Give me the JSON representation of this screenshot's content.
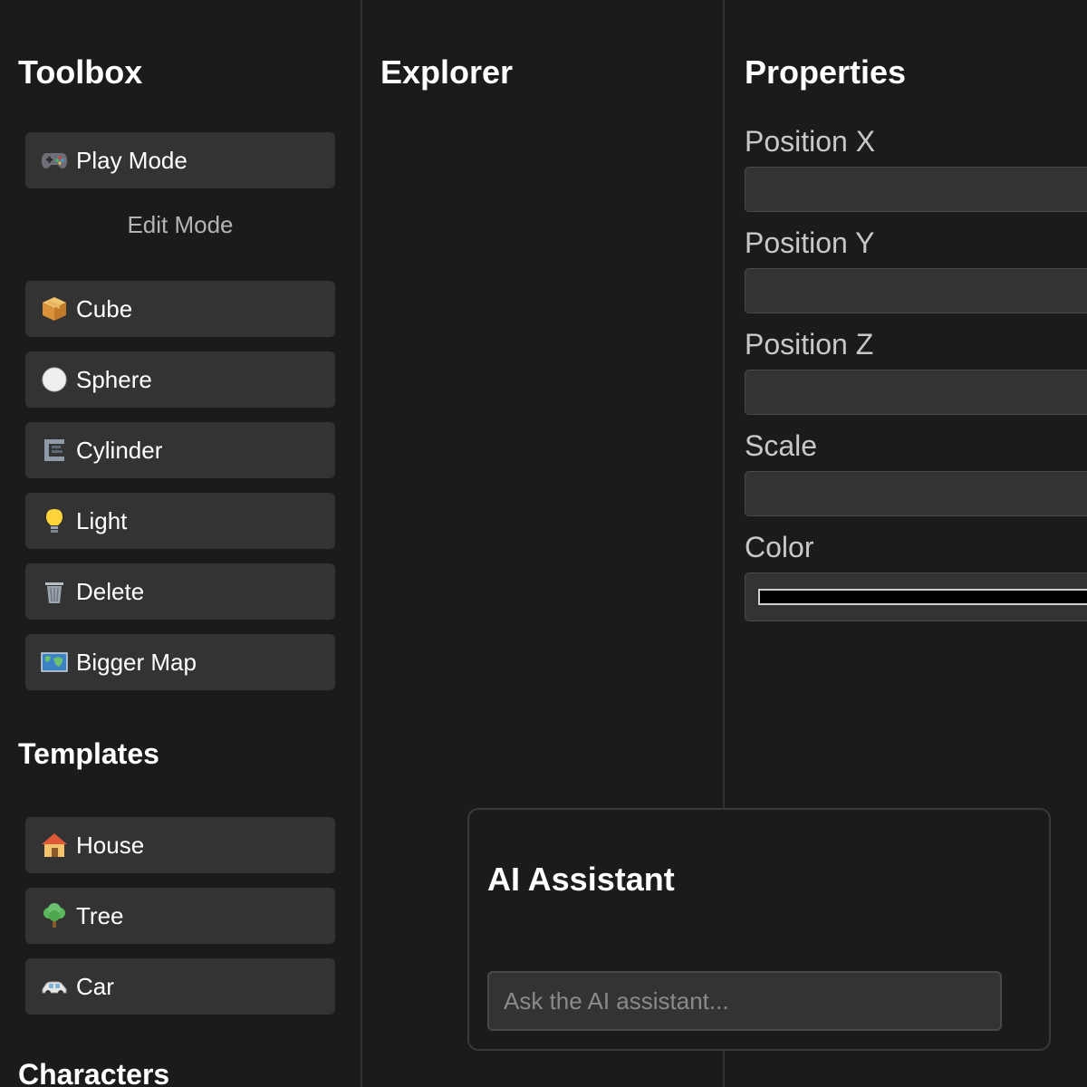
{
  "toolbox": {
    "title": "Toolbox",
    "play_mode": {
      "label": "Play Mode",
      "icon": "gamepad-icon"
    },
    "edit_mode": {
      "label": "Edit Mode"
    },
    "tools": [
      {
        "label": "Cube",
        "icon": "package-icon"
      },
      {
        "label": "Sphere",
        "icon": "white-circle-icon"
      },
      {
        "label": "Cylinder",
        "icon": "cylinder-clamp-icon"
      },
      {
        "label": "Light",
        "icon": "lightbulb-icon"
      },
      {
        "label": "Delete",
        "icon": "trash-icon"
      },
      {
        "label": "Bigger Map",
        "icon": "world-map-icon"
      }
    ],
    "templates_title": "Templates",
    "templates": [
      {
        "label": "House",
        "icon": "house-icon"
      },
      {
        "label": "Tree",
        "icon": "tree-icon"
      },
      {
        "label": "Car",
        "icon": "car-icon"
      }
    ],
    "characters_title": "Characters"
  },
  "explorer": {
    "title": "Explorer"
  },
  "properties": {
    "title": "Properties",
    "fields": [
      {
        "label": "Position X",
        "value": ""
      },
      {
        "label": "Position Y",
        "value": ""
      },
      {
        "label": "Position Z",
        "value": ""
      },
      {
        "label": "Scale",
        "value": ""
      }
    ],
    "color": {
      "label": "Color",
      "value": "#000000"
    }
  },
  "ai_assistant": {
    "title": "AI Assistant",
    "placeholder": "Ask the AI assistant..."
  }
}
